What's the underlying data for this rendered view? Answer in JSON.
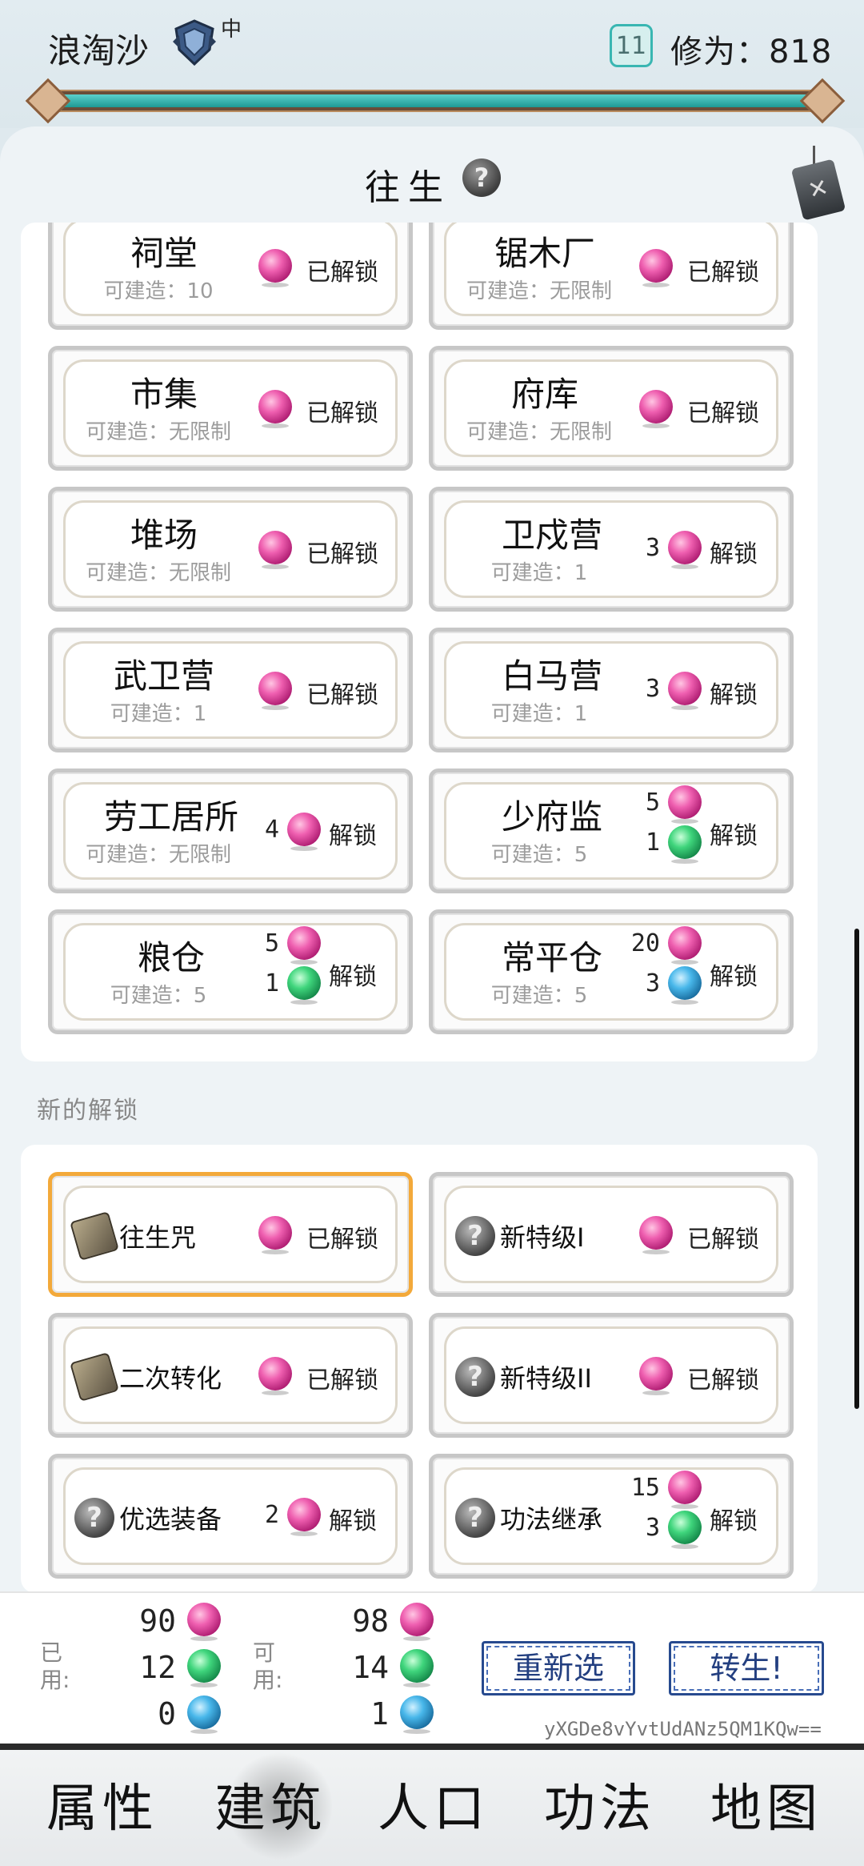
{
  "header": {
    "player_name": "浪淘沙",
    "rank_sub": "中",
    "level": "11",
    "cultivation": "修为：818",
    "progress": 1.0
  },
  "panel": {
    "title": "往生",
    "help_icon": "question-icon",
    "close_icon": "close-tag-icon"
  },
  "buildings": [
    {
      "name": "祠堂",
      "sub": "可建造：10",
      "status": "已解锁"
    },
    {
      "name": "锯木厂",
      "sub": "可建造：无限制",
      "status": "已解锁"
    },
    {
      "name": "市集",
      "sub": "可建造：无限制",
      "status": "已解锁"
    },
    {
      "name": "府库",
      "sub": "可建造：无限制",
      "status": "已解锁"
    },
    {
      "name": "堆场",
      "sub": "可建造：无限制",
      "status": "已解锁"
    },
    {
      "name": "卫戍营",
      "sub": "可建造：1",
      "cost": [
        "3"
      ],
      "status": "解锁"
    },
    {
      "name": "武卫营",
      "sub": "可建造：1",
      "status": "已解锁"
    },
    {
      "name": "白马营",
      "sub": "可建造：1",
      "cost": [
        "3"
      ],
      "status": "解锁"
    },
    {
      "name": "劳工居所",
      "sub": "可建造：无限制",
      "cost": [
        "4"
      ],
      "status": "解锁"
    },
    {
      "name": "少府监",
      "sub": "可建造：5",
      "cost": [
        "5",
        "1"
      ],
      "status": "解锁"
    },
    {
      "name": "粮仓",
      "sub": "可建造：5",
      "cost": [
        "5",
        "1"
      ],
      "status": "解锁"
    },
    {
      "name": "常平仓",
      "sub": "可建造：5",
      "cost": [
        "20",
        "3"
      ],
      "status": "解锁"
    }
  ],
  "new_section_label": "新的解锁",
  "unlocks": [
    {
      "name": "往生咒",
      "icon": "book-icon",
      "status": "已解锁"
    },
    {
      "name": "新特级I",
      "icon": "question-icon",
      "status": "已解锁"
    },
    {
      "name": "二次转化",
      "icon": "book-icon",
      "status": "已解锁"
    },
    {
      "name": "新特级II",
      "icon": "question-icon",
      "status": "已解锁"
    },
    {
      "name": "优选装备",
      "icon": "question-icon",
      "cost": [
        "2"
      ],
      "status": "解锁"
    },
    {
      "name": "功法继承",
      "icon": "question-icon",
      "cost": [
        "15",
        "3"
      ],
      "status": "解锁"
    }
  ],
  "resources": {
    "used_label": "已用:",
    "available_label": "可用:",
    "used": [
      "90",
      "12",
      "0"
    ],
    "available": [
      "98",
      "14",
      "1"
    ]
  },
  "buttons": {
    "reselect": "重新选",
    "rebirth": "转生!"
  },
  "code": "yXGDe8vYvtUdANz5QM1KQw==",
  "nav": [
    "属性",
    "建筑",
    "人口",
    "功法",
    "地图"
  ],
  "colors": {
    "accent_teal": "#39b6b2",
    "selected_border": "#f3a93a",
    "button_blue": "#274a8f",
    "orb_pink": "#ef5fb0",
    "orb_green": "#3fd57c",
    "orb_blue": "#48b7ea"
  }
}
